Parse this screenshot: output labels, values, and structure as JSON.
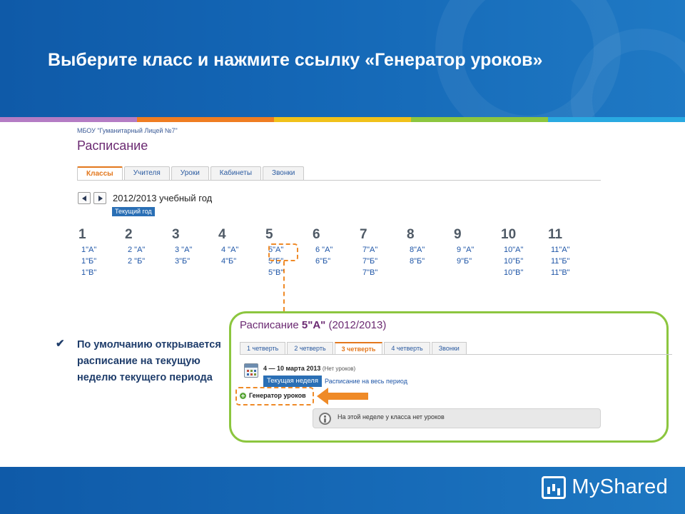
{
  "slide": {
    "title": "Выберите класс и нажмите ссылку «Генератор уроков»",
    "brand": "MyShared",
    "stripe_colors": [
      "#b47cc4",
      "#ef7d22",
      "#f0c11a",
      "#8cc63f",
      "#29a9e1"
    ]
  },
  "app": {
    "school_name": "МБОУ \"Гуманитарный Лицей №7\"",
    "page_title": "Расписание",
    "tabs": [
      "Классы",
      "Учителя",
      "Уроки",
      "Кабинеты",
      "Звонки"
    ],
    "active_tab": "Классы",
    "year_label": "2012/2013 учебный год",
    "current_year_button": "Текущий год",
    "grades": [
      {
        "num": "1",
        "classes": [
          "1\"А\"",
          "1\"Б\"",
          "1\"В\""
        ]
      },
      {
        "num": "2",
        "classes": [
          "2 \"А\"",
          "2 \"Б\""
        ]
      },
      {
        "num": "3",
        "classes": [
          "3 \"А\"",
          "3\"Б\""
        ]
      },
      {
        "num": "4",
        "classes": [
          "4 \"А\"",
          "4\"Б\""
        ]
      },
      {
        "num": "5",
        "classes": [
          "5\"А\"",
          "5\"Б\"",
          "5\"В\""
        ]
      },
      {
        "num": "6",
        "classes": [
          "6 \"А\"",
          "6\"Б\""
        ]
      },
      {
        "num": "7",
        "classes": [
          "7\"А\"",
          "7\"Б\"",
          "7\"В\""
        ]
      },
      {
        "num": "8",
        "classes": [
          "8\"А\"",
          "8\"Б\""
        ]
      },
      {
        "num": "9",
        "classes": [
          "9 \"А\"",
          "9\"Б\""
        ]
      },
      {
        "num": "10",
        "classes": [
          "10\"А\"",
          "10\"Б\"",
          "10\"В\""
        ]
      },
      {
        "num": "11",
        "classes": [
          "11\"А\"",
          "11\"Б\"",
          "11\"В\""
        ]
      }
    ]
  },
  "panel": {
    "title_prefix": "Расписание",
    "title_class": "5\"А\"",
    "title_year": "(2012/2013)",
    "tabs": [
      "1 четверть",
      "2 четверть",
      "3 четверть",
      "4 четверть",
      "Звонки"
    ],
    "active_tab": "3 четверть",
    "week_range": "4 — 10 марта 2013",
    "week_note": "(Нет уроков)",
    "current_week_button": "Текущая неделя",
    "all_period_link": "Расписание на весь период",
    "generator_link": "Генератор уроков",
    "notice": "На этой неделе у класса нет уроков"
  },
  "bullet": {
    "text": "По умолчанию открывается расписание на текущую неделю текущего периода"
  },
  "colors": {
    "accent_orange": "#ef8a27",
    "panel_green": "#8cc63f",
    "header_blue": "#1467b6"
  }
}
